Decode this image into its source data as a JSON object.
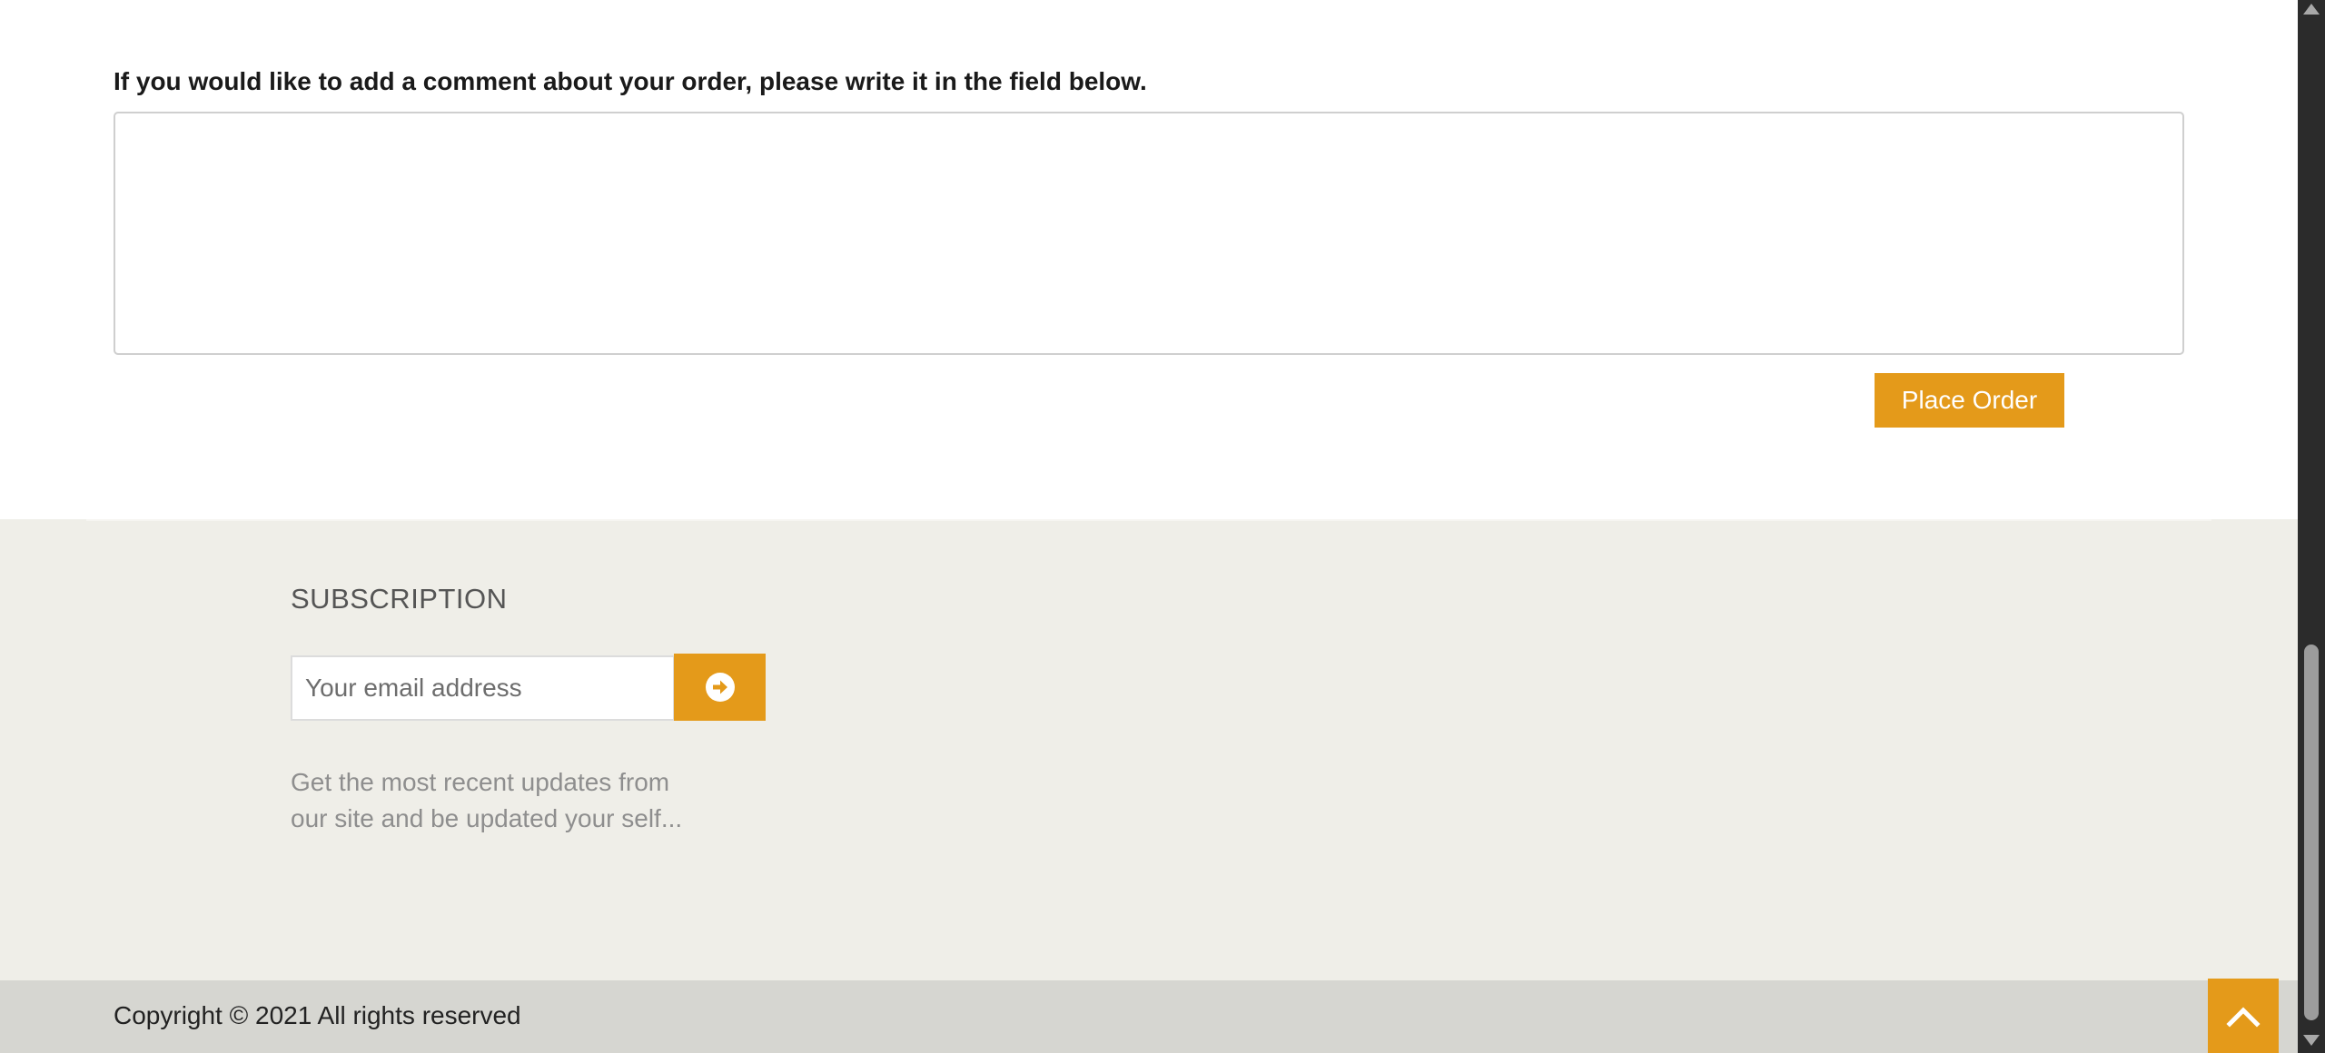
{
  "comment": {
    "label": "If you would like to add a comment about your order, please write it in the field below.",
    "value": "",
    "placeholder": ""
  },
  "order": {
    "place_order_label": "Place Order"
  },
  "subscription": {
    "title": "SUBSCRIPTION",
    "email_placeholder": "Your email address",
    "email_value": "",
    "submit_icon": "circle-arrow-right-icon",
    "description": "Get the most recent updates from our site and be updated your self..."
  },
  "footer": {
    "copyright": "Copyright © 2021 All rights reserved",
    "back_to_top_icon": "chevron-up-icon"
  },
  "colors": {
    "accent": "#e49a1a",
    "footer_bg": "#efeee8",
    "copyright_bg": "#d6d6d1"
  }
}
